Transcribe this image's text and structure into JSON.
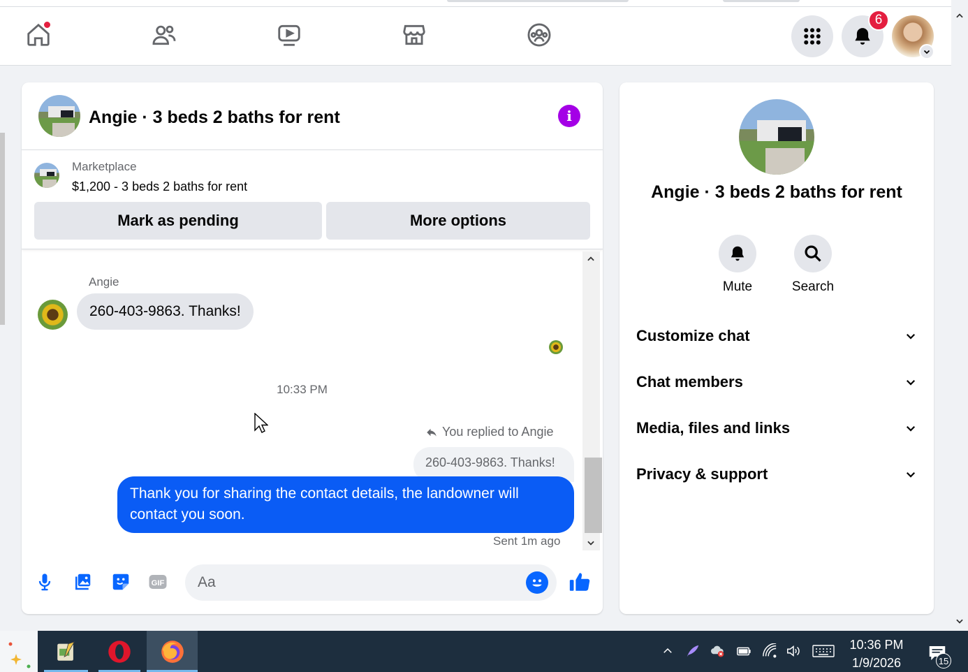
{
  "nav": {
    "notification_count": "6"
  },
  "chat": {
    "title": "Angie · 3 beds 2 baths for rent",
    "marketplace_label": "Marketplace",
    "listing": "$1,200 - 3 beds 2 baths for rent",
    "mark_pending_label": "Mark as pending",
    "more_options_label": "More options",
    "messages": {
      "sender_name": "Angie",
      "incoming_text": "260-403-9863. Thanks!",
      "timestamp": "10:33 PM",
      "reply_note": "You replied to Angie",
      "quoted_text": "260-403-9863. Thanks!",
      "outgoing_text": "Thank you for sharing the contact details, the landowner will contact you soon.",
      "sent_status": "Sent 1m ago"
    },
    "composer_placeholder": "Aa"
  },
  "panel": {
    "title": "Angie · 3 beds 2 baths for rent",
    "mute_label": "Mute",
    "search_label": "Search",
    "sections": [
      "Customize chat",
      "Chat members",
      "Media, files and links",
      "Privacy & support"
    ]
  },
  "taskbar": {
    "time": "10:36 PM",
    "date": "1/9/2026",
    "notification_count": "15"
  },
  "colors": {
    "messenger_blue": "#0a5cf5",
    "info_purple": "#a400e6",
    "badge_red": "#e41e3f"
  }
}
